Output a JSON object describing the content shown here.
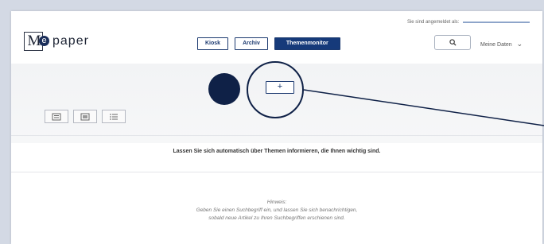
{
  "header": {
    "signed_in_label": "Sie sind angemeldet als:",
    "logo_letter": "M",
    "logo_e": "e",
    "logo_text": "paper",
    "nav": [
      {
        "label": "Kiosk"
      },
      {
        "label": "Archiv"
      },
      {
        "label": "Themenmonitor",
        "active": true
      }
    ],
    "account_label": "Meine Daten"
  },
  "toolbar": {
    "add_label": "+"
  },
  "main": {
    "intro_text": "Lassen Sie sich automatisch über Themen informieren, die Ihnen wichtig sind.",
    "hint_title": "Hinweis:",
    "hint_line1": "Geben Sie einen Suchbegriff ein, und lassen Sie sich benachrichtigen,",
    "hint_line2": "sobald neue Artikel zu Ihren Suchbegriffen erschienen sind."
  },
  "colors": {
    "accent": "#163a7a",
    "annotation": "#0f2147",
    "backdrop": "#d3d9e4"
  },
  "icons": {
    "search": "search-icon",
    "chevron": "chevron-down-icon",
    "grid_large": "grid-large-icon",
    "grid_small": "grid-small-icon",
    "list": "list-view-icon"
  }
}
